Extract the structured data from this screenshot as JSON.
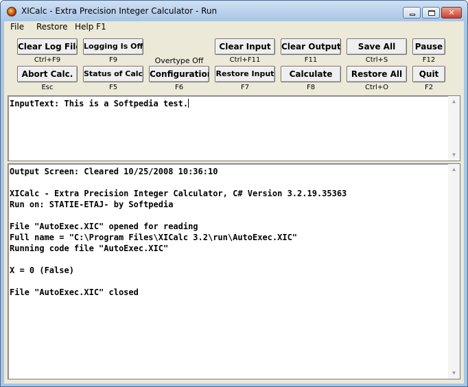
{
  "window": {
    "title": "XICalc - Extra Precision Integer Calculator - Run",
    "close_glyph": "✕"
  },
  "menu": {
    "items": [
      "File",
      "Restore",
      "Help F1"
    ]
  },
  "toolbar": {
    "row1": [
      {
        "label": "Clear Log File",
        "hint": "Ctrl+F9"
      },
      {
        "label": "Logging Is Off",
        "hint": "F9"
      },
      {
        "label": "Clear Input",
        "hint": "Ctrl+F11"
      },
      {
        "label": "Clear Output",
        "hint": "F11"
      },
      {
        "label": "Save All",
        "hint": "Ctrl+S"
      },
      {
        "label": "Pause",
        "hint": "F12"
      }
    ],
    "overtype_status": "Overtype Off",
    "row2": [
      {
        "label": "Abort Calc.",
        "hint": "Esc"
      },
      {
        "label": "Status of Calc.",
        "hint": "F5"
      },
      {
        "label": "Configuration",
        "hint": "F6"
      },
      {
        "label": "Restore Input",
        "hint": "F7"
      },
      {
        "label": "Calculate",
        "hint": "F8"
      },
      {
        "label": "Restore All",
        "hint": "Ctrl+O"
      },
      {
        "label": "Quit",
        "hint": "F2"
      }
    ]
  },
  "input_pane": {
    "text": "InputText: This is a Softpedia test."
  },
  "output_pane": {
    "lines": [
      "Output Screen: Cleared 10/25/2008 10:36:10",
      "",
      "XICalc - Extra Precision Integer Calculator, C# Version 3.2.19.35363",
      "Run on: STATIE-ETAJ- by Softpedia",
      "",
      "File \"AutoExec.XIC\" opened for reading",
      "Full name = \"C:\\Program Files\\XICalc 3.2\\run\\AutoExec.XIC\"",
      "Running code file \"AutoExec.XIC\"",
      "",
      "X = 0 (False)",
      "",
      "File \"AutoExec.XIC\" closed"
    ]
  },
  "scroll": {
    "up_glyph": "▲",
    "down_glyph": "▼"
  }
}
